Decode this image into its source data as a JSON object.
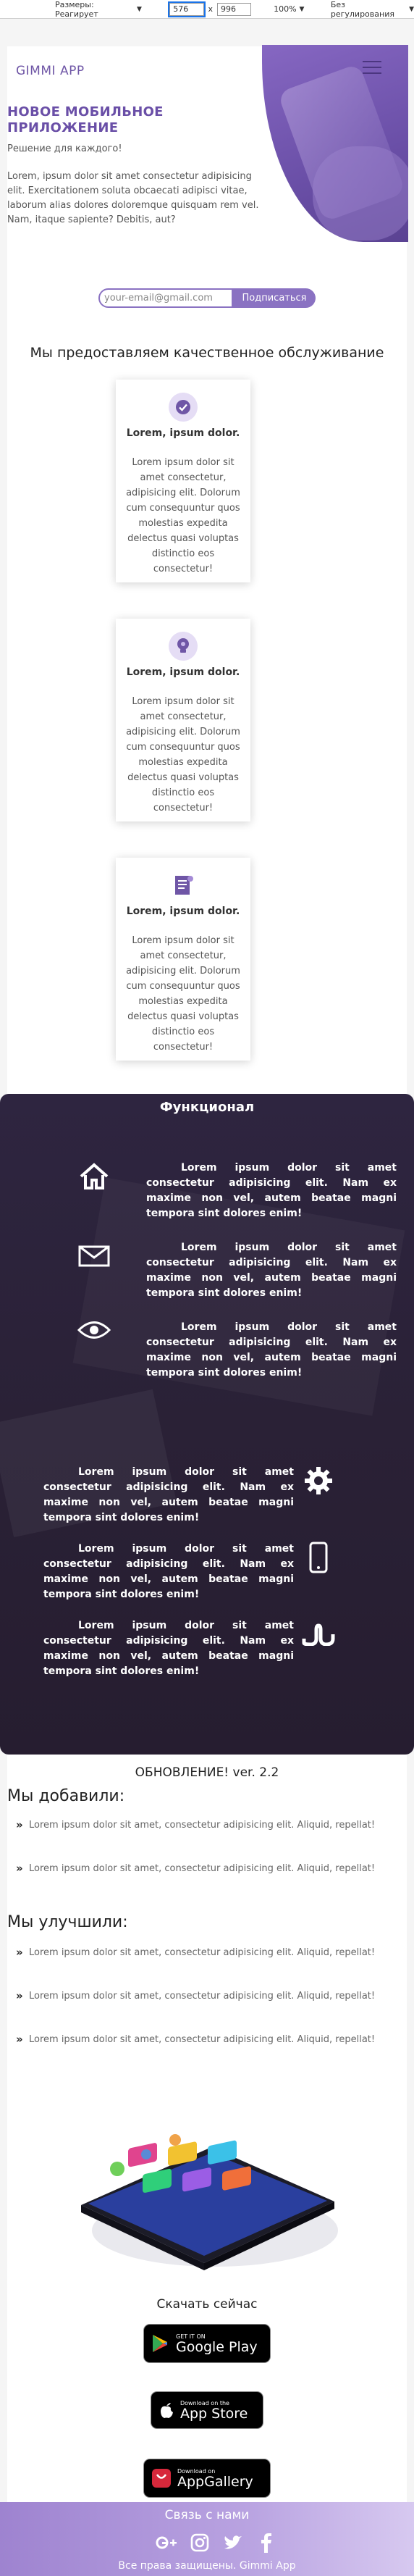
{
  "toolbar": {
    "size_label": "Размеры: Реагирует",
    "width": "576",
    "times": "x",
    "height": "996",
    "zoom": "100%",
    "throttle": "Без регулирования"
  },
  "header": {
    "brand": "GIMMI APP"
  },
  "hero": {
    "title": "НОВОЕ МОБИЛЬНОЕ ПРИЛОЖЕНИЕ",
    "subtitle": "Решение для каждого!",
    "text": "Lorem, ipsum dolor sit amet consectetur adipisicing elit. Exercitationem soluta obcaecati adipisci vitae, laborum alias dolores doloremque quisquam rem vel. Nam, itaque sapiente? Debitis, aut?"
  },
  "subscribe": {
    "placeholder": "your-email@gmail.com",
    "button": "Подписаться"
  },
  "services": {
    "title": "Мы предоставляем качественное обслуживание",
    "cards": [
      {
        "icon": "checkmark-icon",
        "title": "Lorem, ipsum dolor.",
        "text": "Lorem ipsum dolor sit amet consectetur, adipisicing elit. Dolorum cum consequuntur quos molestias expedita delectus quasi voluptas distinctio eos consectetur!"
      },
      {
        "icon": "lightbulb-icon",
        "title": "Lorem, ipsum dolor.",
        "text": "Lorem ipsum dolor sit amet consectetur, adipisicing elit. Dolorum cum consequuntur quos molestias expedita delectus quasi voluptas distinctio eos consectetur!"
      },
      {
        "icon": "document-icon",
        "title": "Lorem, ipsum dolor.",
        "text": "Lorem ipsum dolor sit amet consectetur, adipisicing elit. Dolorum cum consequuntur quos molestias expedita delectus quasi voluptas distinctio eos consectetur!"
      }
    ]
  },
  "features": {
    "title": "Функционал",
    "items": [
      {
        "icon": "home-icon",
        "text": "Lorem ipsum dolor sit amet consectetur adipisicing elit. Nam ex maxime non vel, autem beatae magni tempora sint dolores enim!"
      },
      {
        "icon": "envelope-icon",
        "text": "Lorem ipsum dolor sit amet consectetur adipisicing elit. Nam ex maxime non vel, autem beatae magni tempora sint dolores enim!"
      },
      {
        "icon": "eye-icon",
        "text": "Lorem ipsum dolor sit amet consectetur adipisicing elit. Nam ex maxime non vel, autem beatae magni tempora sint dolores enim!"
      },
      {
        "icon": "gear-icon",
        "text": "Lorem ipsum dolor sit amet consectetur adipisicing elit. Nam ex maxime non vel, autem beatae magni tempora sint dolores enim!"
      },
      {
        "icon": "mobile-icon",
        "text": "Lorem ipsum dolor sit amet consectetur adipisicing elit. Nam ex maxime non vel, autem beatae magni tempora sint dolores enim!"
      },
      {
        "icon": "stumbleupon-icon",
        "text": "Lorem ipsum dolor sit amet consectetur adipisicing elit. Nam ex maxime non vel, autem beatae magni tempora sint dolores enim!"
      }
    ]
  },
  "update": {
    "title": "ОБНОВЛЕНИЕ! ver. 2.2",
    "added_heading": "Мы добавили:",
    "added": [
      "Lorem ipsum dolor sit amet, consectetur adipisicing elit. Aliquid, repellat!",
      "Lorem ipsum dolor sit amet, consectetur adipisicing elit. Aliquid, repellat!"
    ],
    "improved_heading": "Мы улучшили:",
    "improved": [
      "Lorem ipsum dolor sit amet, consectetur adipisicing elit. Aliquid, repellat!",
      "Lorem ipsum dolor sit amet, consectetur adipisicing elit. Aliquid, repellat!",
      "Lorem ipsum dolor sit amet, consectetur adipisicing elit. Aliquid, repellat!"
    ]
  },
  "download": {
    "title": "Скачать сейчас",
    "stores": [
      {
        "small": "GET IT ON",
        "big": "Google Play"
      },
      {
        "small": "Download on the",
        "big": "App Store"
      },
      {
        "small": "Download on",
        "big": "AppGallery"
      }
    ]
  },
  "footer": {
    "title": "Связь с нами",
    "socials": [
      "google-plus-icon",
      "instagram-icon",
      "twitter-icon",
      "facebook-icon"
    ],
    "copyright": "Все права защищены. Gimmi App"
  },
  "colors": {
    "accent": "#6f56a6",
    "accent_light": "#8a72c2",
    "dark": "#2a2136"
  }
}
